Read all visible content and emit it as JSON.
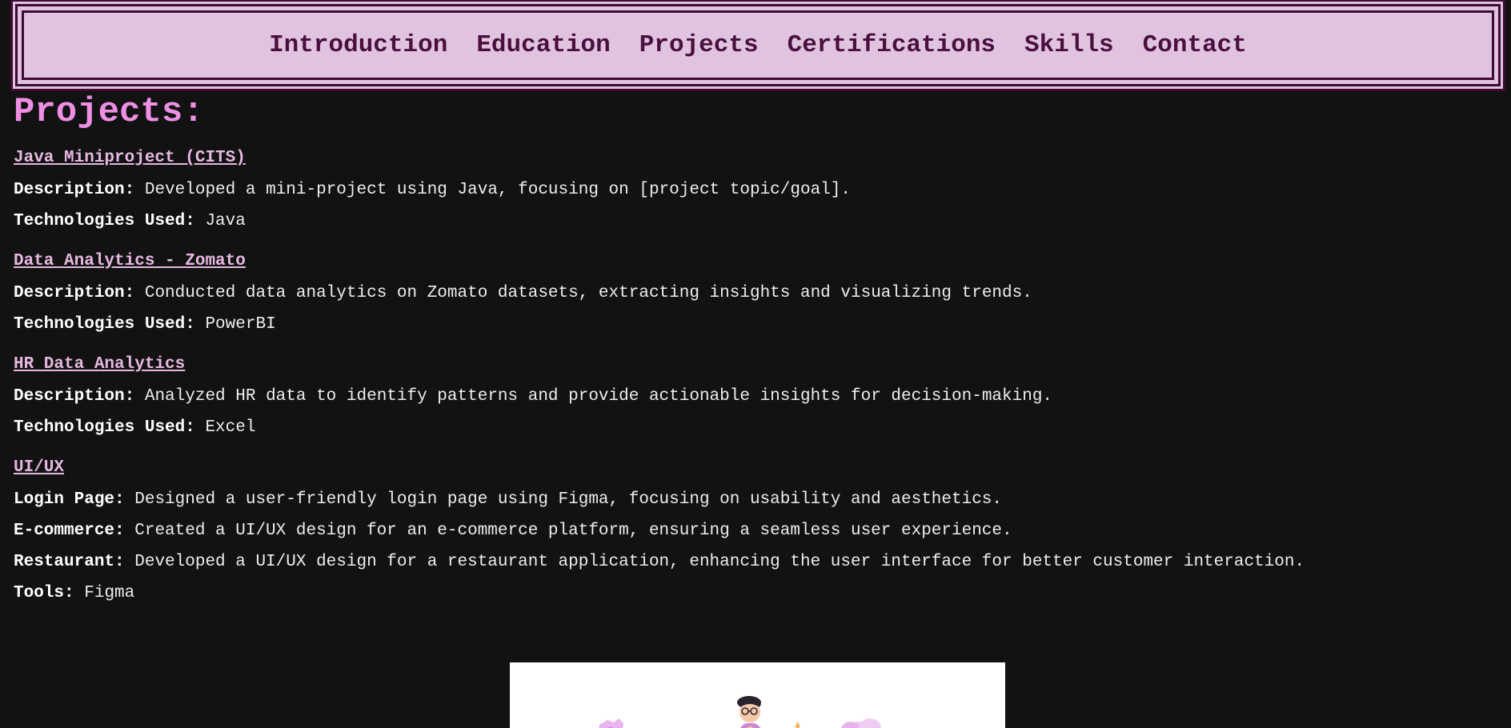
{
  "nav": {
    "items": [
      {
        "label": "Introduction"
      },
      {
        "label": "Education"
      },
      {
        "label": "Projects"
      },
      {
        "label": "Certifications"
      },
      {
        "label": "Skills"
      },
      {
        "label": "Contact"
      }
    ]
  },
  "main": {
    "title": "Projects:",
    "projects": [
      {
        "title": "Java Miniproject (CITS)",
        "lines": [
          {
            "label": "Description:",
            "value": "Developed a mini-project using Java, focusing on [project topic/goal]."
          },
          {
            "label": "Technologies Used:",
            "value": "Java"
          }
        ]
      },
      {
        "title": "Data Analytics - Zomato",
        "lines": [
          {
            "label": "Description:",
            "value": "Conducted data analytics on Zomato datasets, extracting insights and visualizing trends."
          },
          {
            "label": "Technologies Used:",
            "value": "PowerBI"
          }
        ]
      },
      {
        "title": "HR Data Analytics",
        "lines": [
          {
            "label": "Description:",
            "value": "Analyzed HR data to identify patterns and provide actionable insights for decision-making."
          },
          {
            "label": "Technologies Used:",
            "value": "Excel"
          }
        ]
      },
      {
        "title": "UI/UX",
        "lines": [
          {
            "label": "Login Page:",
            "value": "Designed a user-friendly login page using Figma, focusing on usability and aesthetics."
          },
          {
            "label": "E-commerce:",
            "value": "Created a UI/UX design for an e-commerce platform, ensuring a seamless user experience."
          },
          {
            "label": "Restaurant:",
            "value": "Developed a UI/UX design for a restaurant application, enhancing the user interface for better customer interaction."
          },
          {
            "label": "Tools:",
            "value": "Figma"
          }
        ]
      }
    ]
  },
  "colors": {
    "background": "#121212",
    "nav_bg": "#e0c4df",
    "nav_text": "#4a0f3f",
    "title": "#ee8fe4",
    "link": "#e6b8e1"
  },
  "illustration": {
    "icon": "person-with-clouds-illustration"
  }
}
